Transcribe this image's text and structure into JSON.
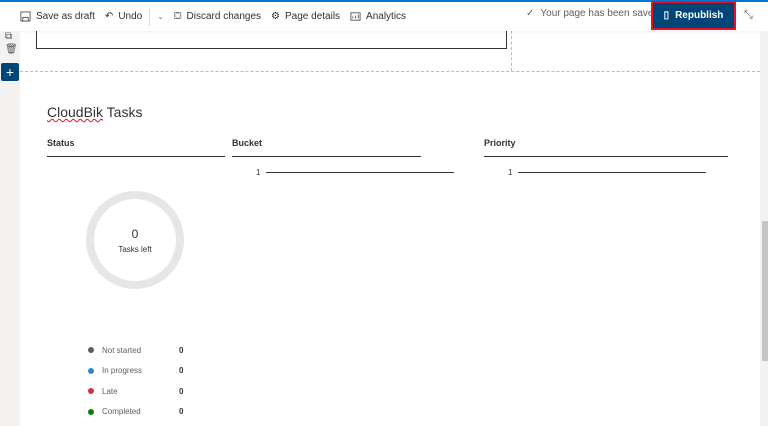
{
  "toolbar": {
    "save_draft": "Save as draft",
    "undo": "Undo",
    "discard": "Discard changes",
    "page_details": "Page details",
    "analytics": "Analytics",
    "saved_status": "Your page has been saved",
    "republish": "Republish"
  },
  "webpart": {
    "title_a": "CloudBik",
    "title_b": " Tasks",
    "columns": [
      "Status",
      "Bucket",
      "Priority"
    ],
    "bucket_row": {
      "label": "1"
    },
    "priority_row": {
      "label": "1"
    },
    "donut": {
      "count": "0",
      "label": "Tasks left"
    },
    "legend": [
      {
        "label": "Not started",
        "value": "0",
        "color": "#605e5c"
      },
      {
        "label": "In progress",
        "value": "0",
        "color": "#2b88d8"
      },
      {
        "label": "Late",
        "value": "0",
        "color": "#d13438"
      },
      {
        "label": "Completed",
        "value": "0",
        "color": "#107c10"
      }
    ]
  },
  "colors": {
    "accent": "#004578",
    "highlight": "#e81123"
  }
}
